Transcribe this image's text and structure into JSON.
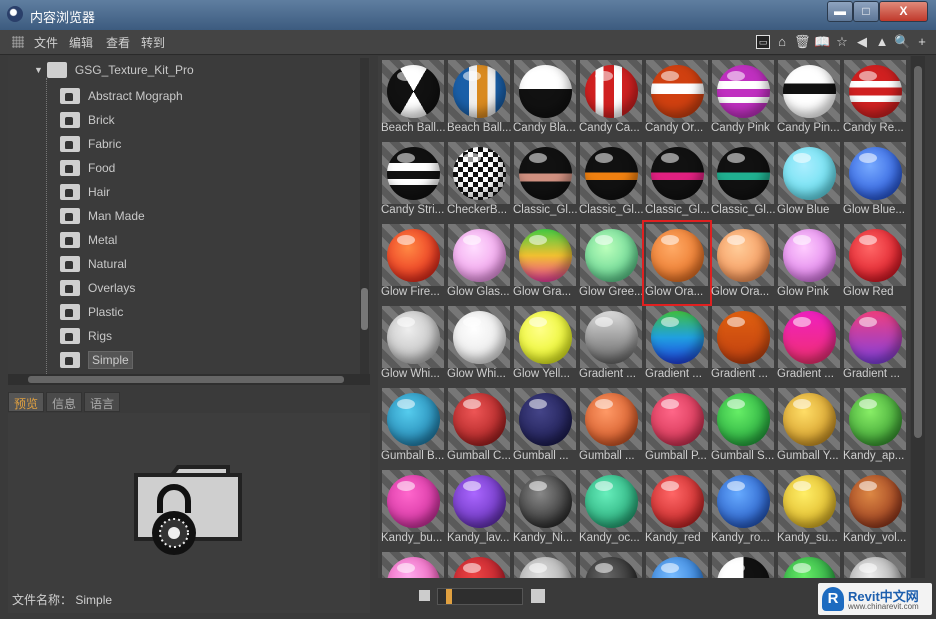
{
  "window": {
    "title": "内容浏览器",
    "min_label": "▬",
    "max_label": "□",
    "close_label": "X"
  },
  "menu": {
    "file": "文件",
    "edit": "编辑",
    "view": "查看",
    "goto": "转到"
  },
  "toolbar": {
    "icons": [
      "preview-icon",
      "home-icon",
      "trash-icon",
      "book-icon",
      "star-icon",
      "back-icon",
      "up-icon",
      "search-icon",
      "add-icon"
    ],
    "glyphs": [
      "▭",
      "⌂",
      "🗑",
      "📖",
      "☆",
      "◀",
      "▲",
      "🔍",
      "+"
    ]
  },
  "tree": {
    "root": "GSG_Texture_Kit_Pro",
    "items": [
      "Abstract Mograph",
      "Brick",
      "Fabric",
      "Food",
      "Hair",
      "Man Made",
      "Metal",
      "Natural",
      "Overlays",
      "Plastic",
      "Rigs",
      "Simple"
    ],
    "selected": "Simple"
  },
  "tabs": [
    {
      "label": "预览",
      "active": true
    },
    {
      "label": "信息",
      "active": false
    },
    {
      "label": "语言",
      "active": false
    }
  ],
  "preview": {
    "filename_label": "文件名称：",
    "filename": "Simple"
  },
  "materials": [
    {
      "name": "Beach Ball...",
      "bg": "conic-gradient(#fff 0 30deg,#111 30deg 150deg,#fff 150deg 210deg,#111 210deg 330deg,#fff 330deg)"
    },
    {
      "name": "Beach Ball...",
      "bg": "linear-gradient(90deg,#1a5fa8 0 30%,#f0f0f0 30% 45%,#d98a20 45% 65%,#f0f0f0 65% 80%,#1a5fa8 80%)"
    },
    {
      "name": "Candy Bla...",
      "bg": "linear-gradient(#fff 0 45%,#111 45%)"
    },
    {
      "name": "Candy Ca...",
      "bg": "linear-gradient(90deg,#d02020 0 20%,#fff 20% 35%,#d02020 35% 55%,#fff 55% 70%,#d02020 70%)"
    },
    {
      "name": "Candy Or...",
      "bg": "linear-gradient(#d04010 0 35%,#fff 35% 55%,#d04010 55%)"
    },
    {
      "name": "Candy Pink",
      "bg": "linear-gradient(#c030c0 0 30%,#fff 30% 45%,#c030c0 45% 60%,#fff 60% 72%,#c030c0 72%)"
    },
    {
      "name": "Candy Pin...",
      "bg": "linear-gradient(#fff 0 35%,#111 35% 55%,#fff 55%)"
    },
    {
      "name": "Candy Re...",
      "bg": "linear-gradient(#d02020 0 30%,#fff 30% 42%,#d02020 42% 58%,#fff 58% 70%,#d02020 70%)"
    },
    {
      "name": "Candy Stri...",
      "bg": "linear-gradient(#111 0 30%,#fff 30% 45%,#111 45% 60%,#fff 60% 72%,#111 72%)"
    },
    {
      "name": "CheckerB...",
      "bg": "repeating-conic-gradient(#111 0 25%,#fff 0 50%) 0 0/10px 10px"
    },
    {
      "name": "Classic_Gl...",
      "bg": "linear-gradient(#111 0 50%,#d09080 50% 65%,#111 65%)"
    },
    {
      "name": "Classic_Gl...",
      "bg": "linear-gradient(#111 0 48%,#f08010 48% 62%,#111 62%)"
    },
    {
      "name": "Classic_Gl...",
      "bg": "linear-gradient(#111 0 48%,#e02080 48% 62%,#111 62%)"
    },
    {
      "name": "Classic_Gl...",
      "bg": "linear-gradient(#111 0 48%,#20b090 48% 62%,#111 62%)"
    },
    {
      "name": "Glow Blue",
      "bg": "radial-gradient(circle at 40% 35%,#aef,#4cd8e8)"
    },
    {
      "name": "Glow Blue...",
      "bg": "radial-gradient(circle at 40% 35%,#7af,#1040d0)"
    },
    {
      "name": "Glow Fire...",
      "bg": "radial-gradient(circle at 40% 35%,#f84,#e01010)"
    },
    {
      "name": "Glow Glas...",
      "bg": "radial-gradient(circle at 40% 35%,#fdf,#e880e0)"
    },
    {
      "name": "Glow Gra...",
      "bg": "linear-gradient(#4c4 0,#f0c030 50%,#f040a0)"
    },
    {
      "name": "Glow Gree...",
      "bg": "radial-gradient(circle at 40% 35%,#bfb,#40c080)"
    },
    {
      "name": "Glow Ora...",
      "bg": "radial-gradient(circle at 40% 35%,#fa6,#e06010)"
    },
    {
      "name": "Glow Ora...",
      "bg": "radial-gradient(circle at 40% 35%,#fc9,#f08040)"
    },
    {
      "name": "Glow Pink",
      "bg": "radial-gradient(circle at 40% 35%,#fcf,#d060e0)"
    },
    {
      "name": "Glow Red",
      "bg": "radial-gradient(circle at 40% 35%,#f66,#d00010)"
    },
    {
      "name": "Glow Whi...",
      "bg": "radial-gradient(circle at 40% 35%,#eee,#aaa)"
    },
    {
      "name": "Glow Whi...",
      "bg": "radial-gradient(circle at 40% 35%,#fff,#ddd)"
    },
    {
      "name": "Glow Yell...",
      "bg": "radial-gradient(circle at 40% 35%,#ff8,#e0f000)"
    },
    {
      "name": "Gradient ...",
      "bg": "linear-gradient(#ddd,#666)"
    },
    {
      "name": "Gradient ...",
      "bg": "linear-gradient(#40c040,#20a0e0 50%,#2040e0)"
    },
    {
      "name": "Gradient ...",
      "bg": "linear-gradient(#e06010,#c04010)"
    },
    {
      "name": "Gradient ...",
      "bg": "linear-gradient(#f020c0,#f03070)"
    },
    {
      "name": "Gradient ...",
      "bg": "linear-gradient(#f04080,#8040e0)"
    },
    {
      "name": "Gumball B...",
      "bg": "radial-gradient(circle at 40% 35%,#5ce,#106a9a)"
    },
    {
      "name": "Gumball C...",
      "bg": "radial-gradient(circle at 40% 35%,#e55,#901010)"
    },
    {
      "name": "Gumball ...",
      "bg": "radial-gradient(circle at 40% 35%,#448,#101040)"
    },
    {
      "name": "Gumball ...",
      "bg": "radial-gradient(circle at 40% 35%,#f96,#c04010)"
    },
    {
      "name": "Gumball P...",
      "bg": "radial-gradient(circle at 40% 35%,#f68,#c02040)"
    },
    {
      "name": "Gumball S...",
      "bg": "radial-gradient(circle at 40% 35%,#6e6,#109030)"
    },
    {
      "name": "Gumball Y...",
      "bg": "radial-gradient(circle at 40% 35%,#fd6,#c08010)"
    },
    {
      "name": "Kandy_ap...",
      "bg": "radial-gradient(circle at 40% 35%,#8e6,#208020)"
    },
    {
      "name": "Kandy_bu...",
      "bg": "radial-gradient(circle at 40% 35%,#f6c,#c02090)"
    },
    {
      "name": "Kandy_lav...",
      "bg": "radial-gradient(circle at 40% 35%,#a6f,#5020a0)"
    },
    {
      "name": "Kandy_Ni...",
      "bg": "radial-gradient(circle at 40% 35%,#888,#111)"
    },
    {
      "name": "Kandy_oc...",
      "bg": "radial-gradient(circle at 40% 35%,#6eb,#109060)"
    },
    {
      "name": "Kandy_red",
      "bg": "radial-gradient(circle at 40% 35%,#f66,#b01010)"
    },
    {
      "name": "Kandy_ro...",
      "bg": "radial-gradient(circle at 40% 35%,#6af,#1040b0)"
    },
    {
      "name": "Kandy_su...",
      "bg": "radial-gradient(circle at 40% 35%,#fe6,#d0a010)"
    },
    {
      "name": "Kandy_vol...",
      "bg": "radial-gradient(circle at 40% 35%,#d84,#802010)"
    },
    {
      "name": "",
      "bg": "radial-gradient(circle at 40% 35%,#fae,#e040a0)"
    },
    {
      "name": "",
      "bg": "radial-gradient(circle at 40% 35%,#e44,#a01020)"
    },
    {
      "name": "",
      "bg": "radial-gradient(circle at 40% 35%,#ddd,#999)"
    },
    {
      "name": "",
      "bg": "radial-gradient(circle at 40% 35%,#666,#111)"
    },
    {
      "name": "",
      "bg": "radial-gradient(circle at 40% 35%,#7bf,#1060c0)"
    },
    {
      "name": "",
      "bg": "linear-gradient(90deg,#fff 50%,#111 50%)"
    },
    {
      "name": "",
      "bg": "radial-gradient(circle at 40% 35%,#6e6,#108030)"
    },
    {
      "name": "",
      "bg": "radial-gradient(circle at 40% 35%,#eee,#888)"
    }
  ],
  "selected_material_index": 20,
  "watermark": {
    "logo": "R",
    "brand": "Revit中文网",
    "url": "www.chinarevit.com"
  }
}
